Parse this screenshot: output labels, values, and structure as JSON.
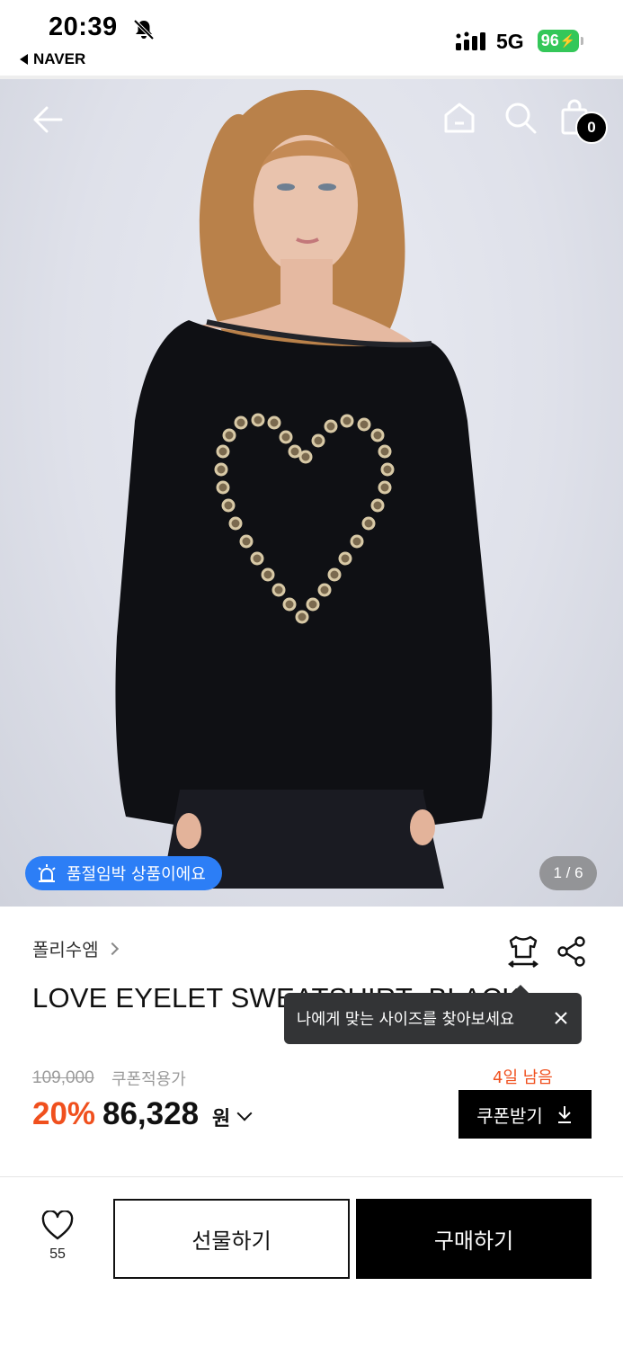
{
  "status_bar": {
    "time": "20:39",
    "back_app": "NAVER",
    "network": "5G",
    "battery": "96"
  },
  "header": {
    "cart_count": "0"
  },
  "gallery": {
    "stock_badge": "품절임박 상품이에요",
    "page_indicator": "1 / 6"
  },
  "product": {
    "brand": "폴리수엠",
    "title": "LOVE EYELET SWEATSHIRT_BLACK",
    "tooltip": "나에게 맞는 사이즈를 찾아보세요",
    "original_price": "109,000",
    "coupon_note": "쿠폰적용가",
    "discount": "20%",
    "price": "86,328",
    "currency": "원",
    "days_left": "4일 남음",
    "coupon_button": "쿠폰받기"
  },
  "actions": {
    "like_count": "55",
    "gift_button": "선물하기",
    "buy_button": "구매하기"
  },
  "colors": {
    "accent_orange": "#f0501e",
    "badge_blue": "#2c7ef6",
    "battery_green": "#34c759"
  }
}
